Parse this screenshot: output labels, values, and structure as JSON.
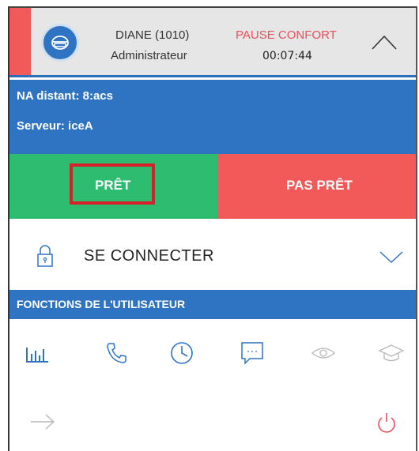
{
  "header": {
    "user_name": "DIANE (1010)",
    "user_role": "Administrateur",
    "pause_status": "PAUSE CONFORT",
    "pause_timer": "00:07:44",
    "status_color": "#f25a5a"
  },
  "info": {
    "remote_agent": "NA distant: 8:acs",
    "server": "Serveur: iceA"
  },
  "actions": {
    "ready_label": "PRÊT",
    "not_ready_label": "PAS PRÊT",
    "ready_color": "#2ebc71",
    "not_ready_color": "#f25a5a"
  },
  "connect": {
    "label": "SE CONNECTER"
  },
  "functions": {
    "title": "FONCTIONS DE L'UTILISATEUR",
    "icons": [
      "chart-icon",
      "phone-icon",
      "clock-icon",
      "chat-icon",
      "eye-icon",
      "graduation-cap-icon"
    ]
  },
  "footer": {
    "icons": [
      "arrow-right-icon",
      "power-icon"
    ]
  },
  "colors": {
    "accent": "#2f74c3",
    "header_bg": "#e6e6e6"
  }
}
